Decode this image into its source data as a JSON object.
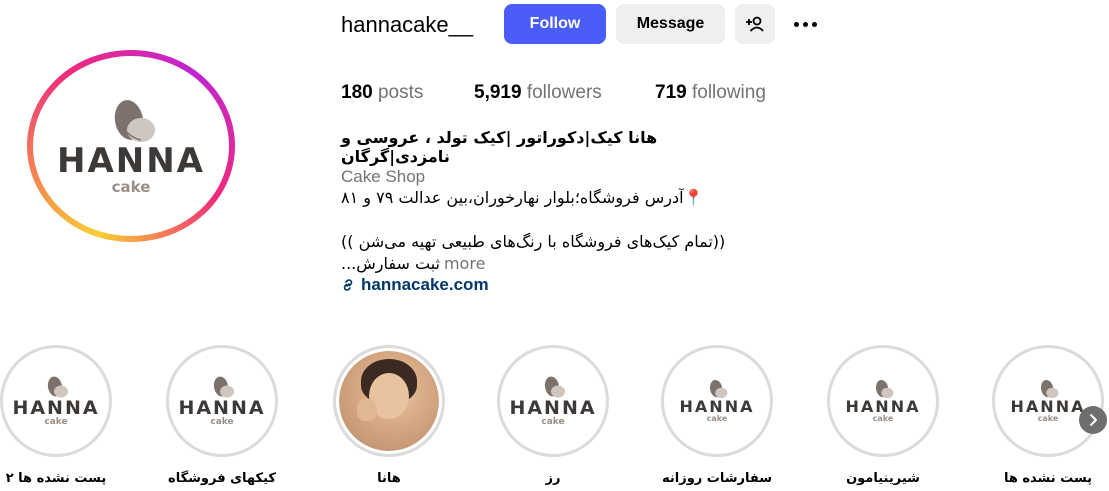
{
  "profile": {
    "username": "hannacake__",
    "avatar_logo": {
      "word": "HANNA",
      "sub": "cake"
    },
    "follow_label": "Follow",
    "message_label": "Message",
    "add_user_icon": "person-add-icon",
    "more_icon": "more-horizontal-icon",
    "stats": {
      "posts_count": "180",
      "posts_label": "posts",
      "followers_count": "5,919",
      "followers_label": "followers",
      "following_count": "719",
      "following_label": "following"
    },
    "bio": {
      "name": "هانا کیک|دکوراتور |کیک تولد ، عروسی و نامزدی|گرگان",
      "category": "Cake Shop",
      "line1": "📍آدرس فروشگاه؛بلوار نهارخوران،بین عدالت ۷۹ و ۸۱",
      "line2": "((تمام کیک‌های فروشگاه با رنگ‌های طبیعی تهیه می‌شن ))",
      "line3": "ثبت سفارش...",
      "more": "more",
      "link": "hannacake.com",
      "link_icon": "link-icon"
    }
  },
  "highlights": [
    {
      "label": "پست نشده ها ۲",
      "image": "logo"
    },
    {
      "label": "کیکهای فروشگاه",
      "image": "logo"
    },
    {
      "label": "هانا",
      "image": "photo"
    },
    {
      "label": "رز",
      "image": "logo"
    },
    {
      "label": "سفارشات روزانه",
      "image": "logo"
    },
    {
      "label": "شیرینیامون",
      "image": "logo"
    },
    {
      "label": "پست نشده ها",
      "image": "logo"
    }
  ],
  "next_icon": "chevron-right-icon",
  "colors": {
    "follow_bg": "#4a5df9",
    "secondary_bg": "#efefef",
    "link": "#00376b",
    "muted": "#737373"
  }
}
